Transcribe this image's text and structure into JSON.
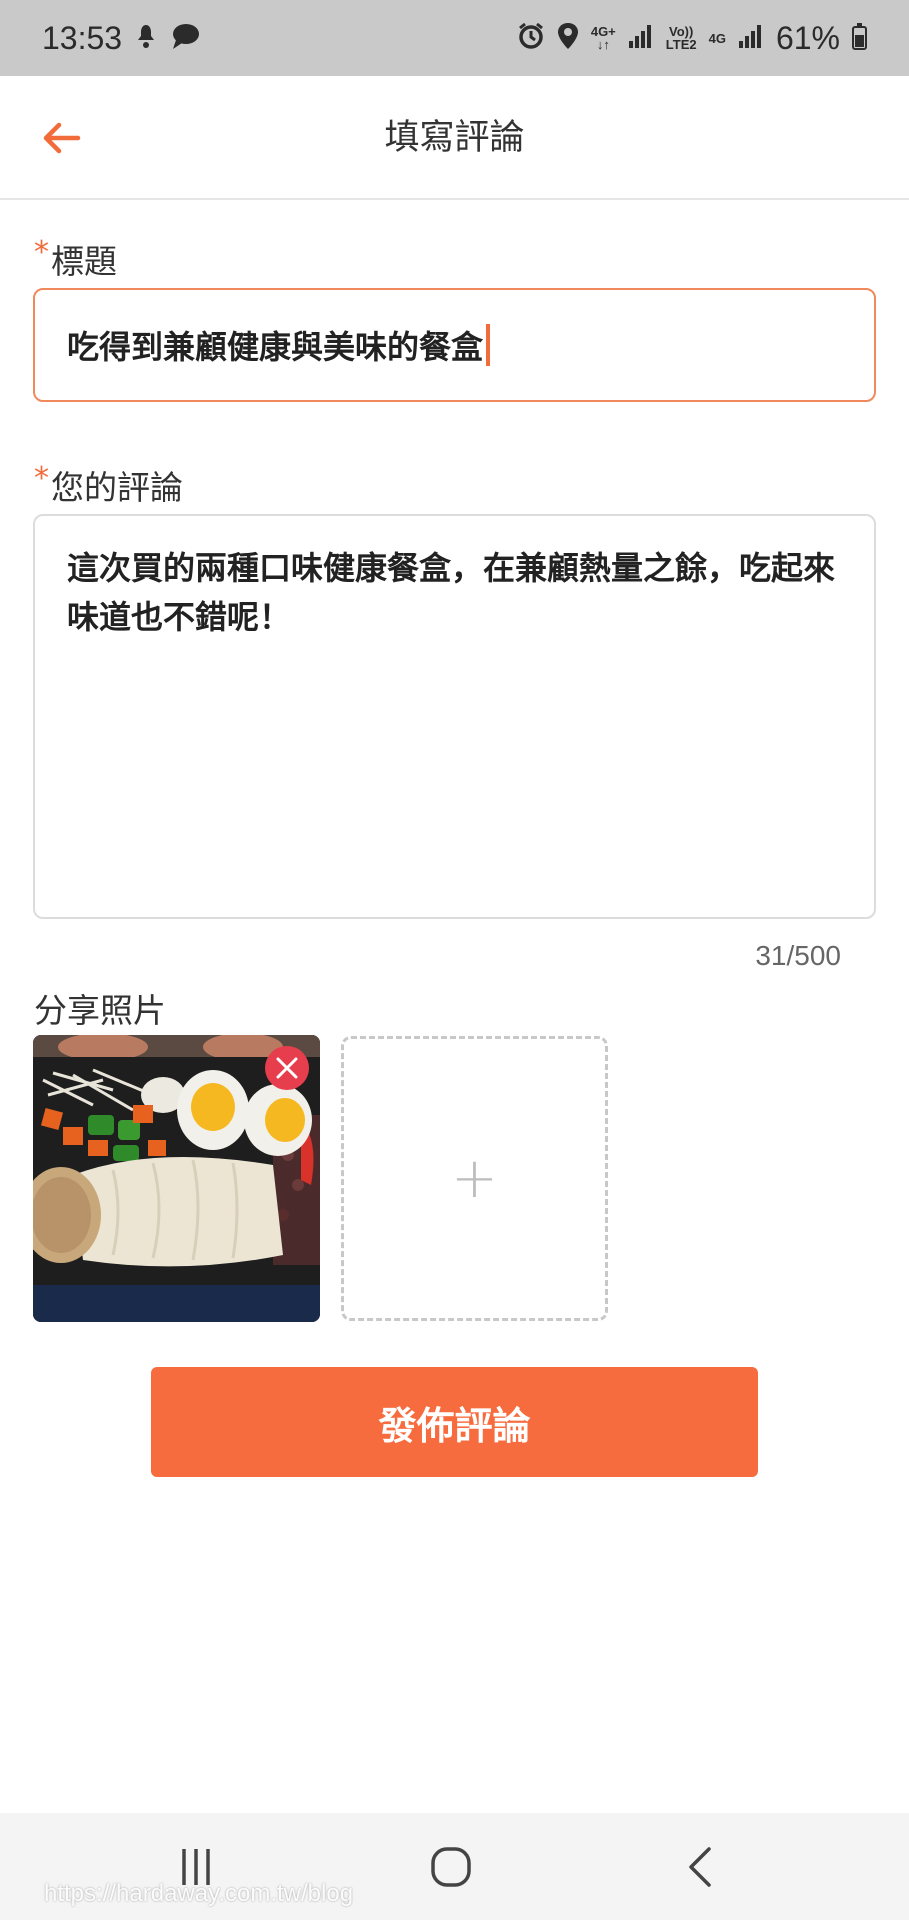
{
  "status_bar": {
    "time": "13:53",
    "network_top": "4G+",
    "volte_top": "Vo))",
    "volte_bottom": "LTE2",
    "network2": "4G",
    "battery_percent": "61%",
    "icons": [
      "notification-icon",
      "chat-bubble-icon",
      "alarm-icon",
      "location-icon",
      "signal-icon",
      "battery-icon"
    ]
  },
  "header": {
    "back_icon": "arrow-left-icon",
    "title": "填寫評論"
  },
  "form": {
    "title_label": "標題",
    "title_value": "吃得到兼顧健康與美味的餐盒",
    "review_label": "您的評論",
    "review_value": "這次買的兩種口味健康餐盒，在兼顧熱量之餘，吃起來味道也不錯呢！",
    "char_count": "31/500",
    "photos_label": "分享照片",
    "required_mark": "*",
    "add_photo_symbol": "+",
    "submit_label": "發佈評論"
  },
  "colors": {
    "accent": "#f76c3e",
    "remove": "#e63e4d"
  },
  "nav": {
    "icons": [
      "recent-apps-icon",
      "home-icon",
      "back-icon"
    ]
  },
  "watermark": "https://hardaway.com.tw/blog"
}
